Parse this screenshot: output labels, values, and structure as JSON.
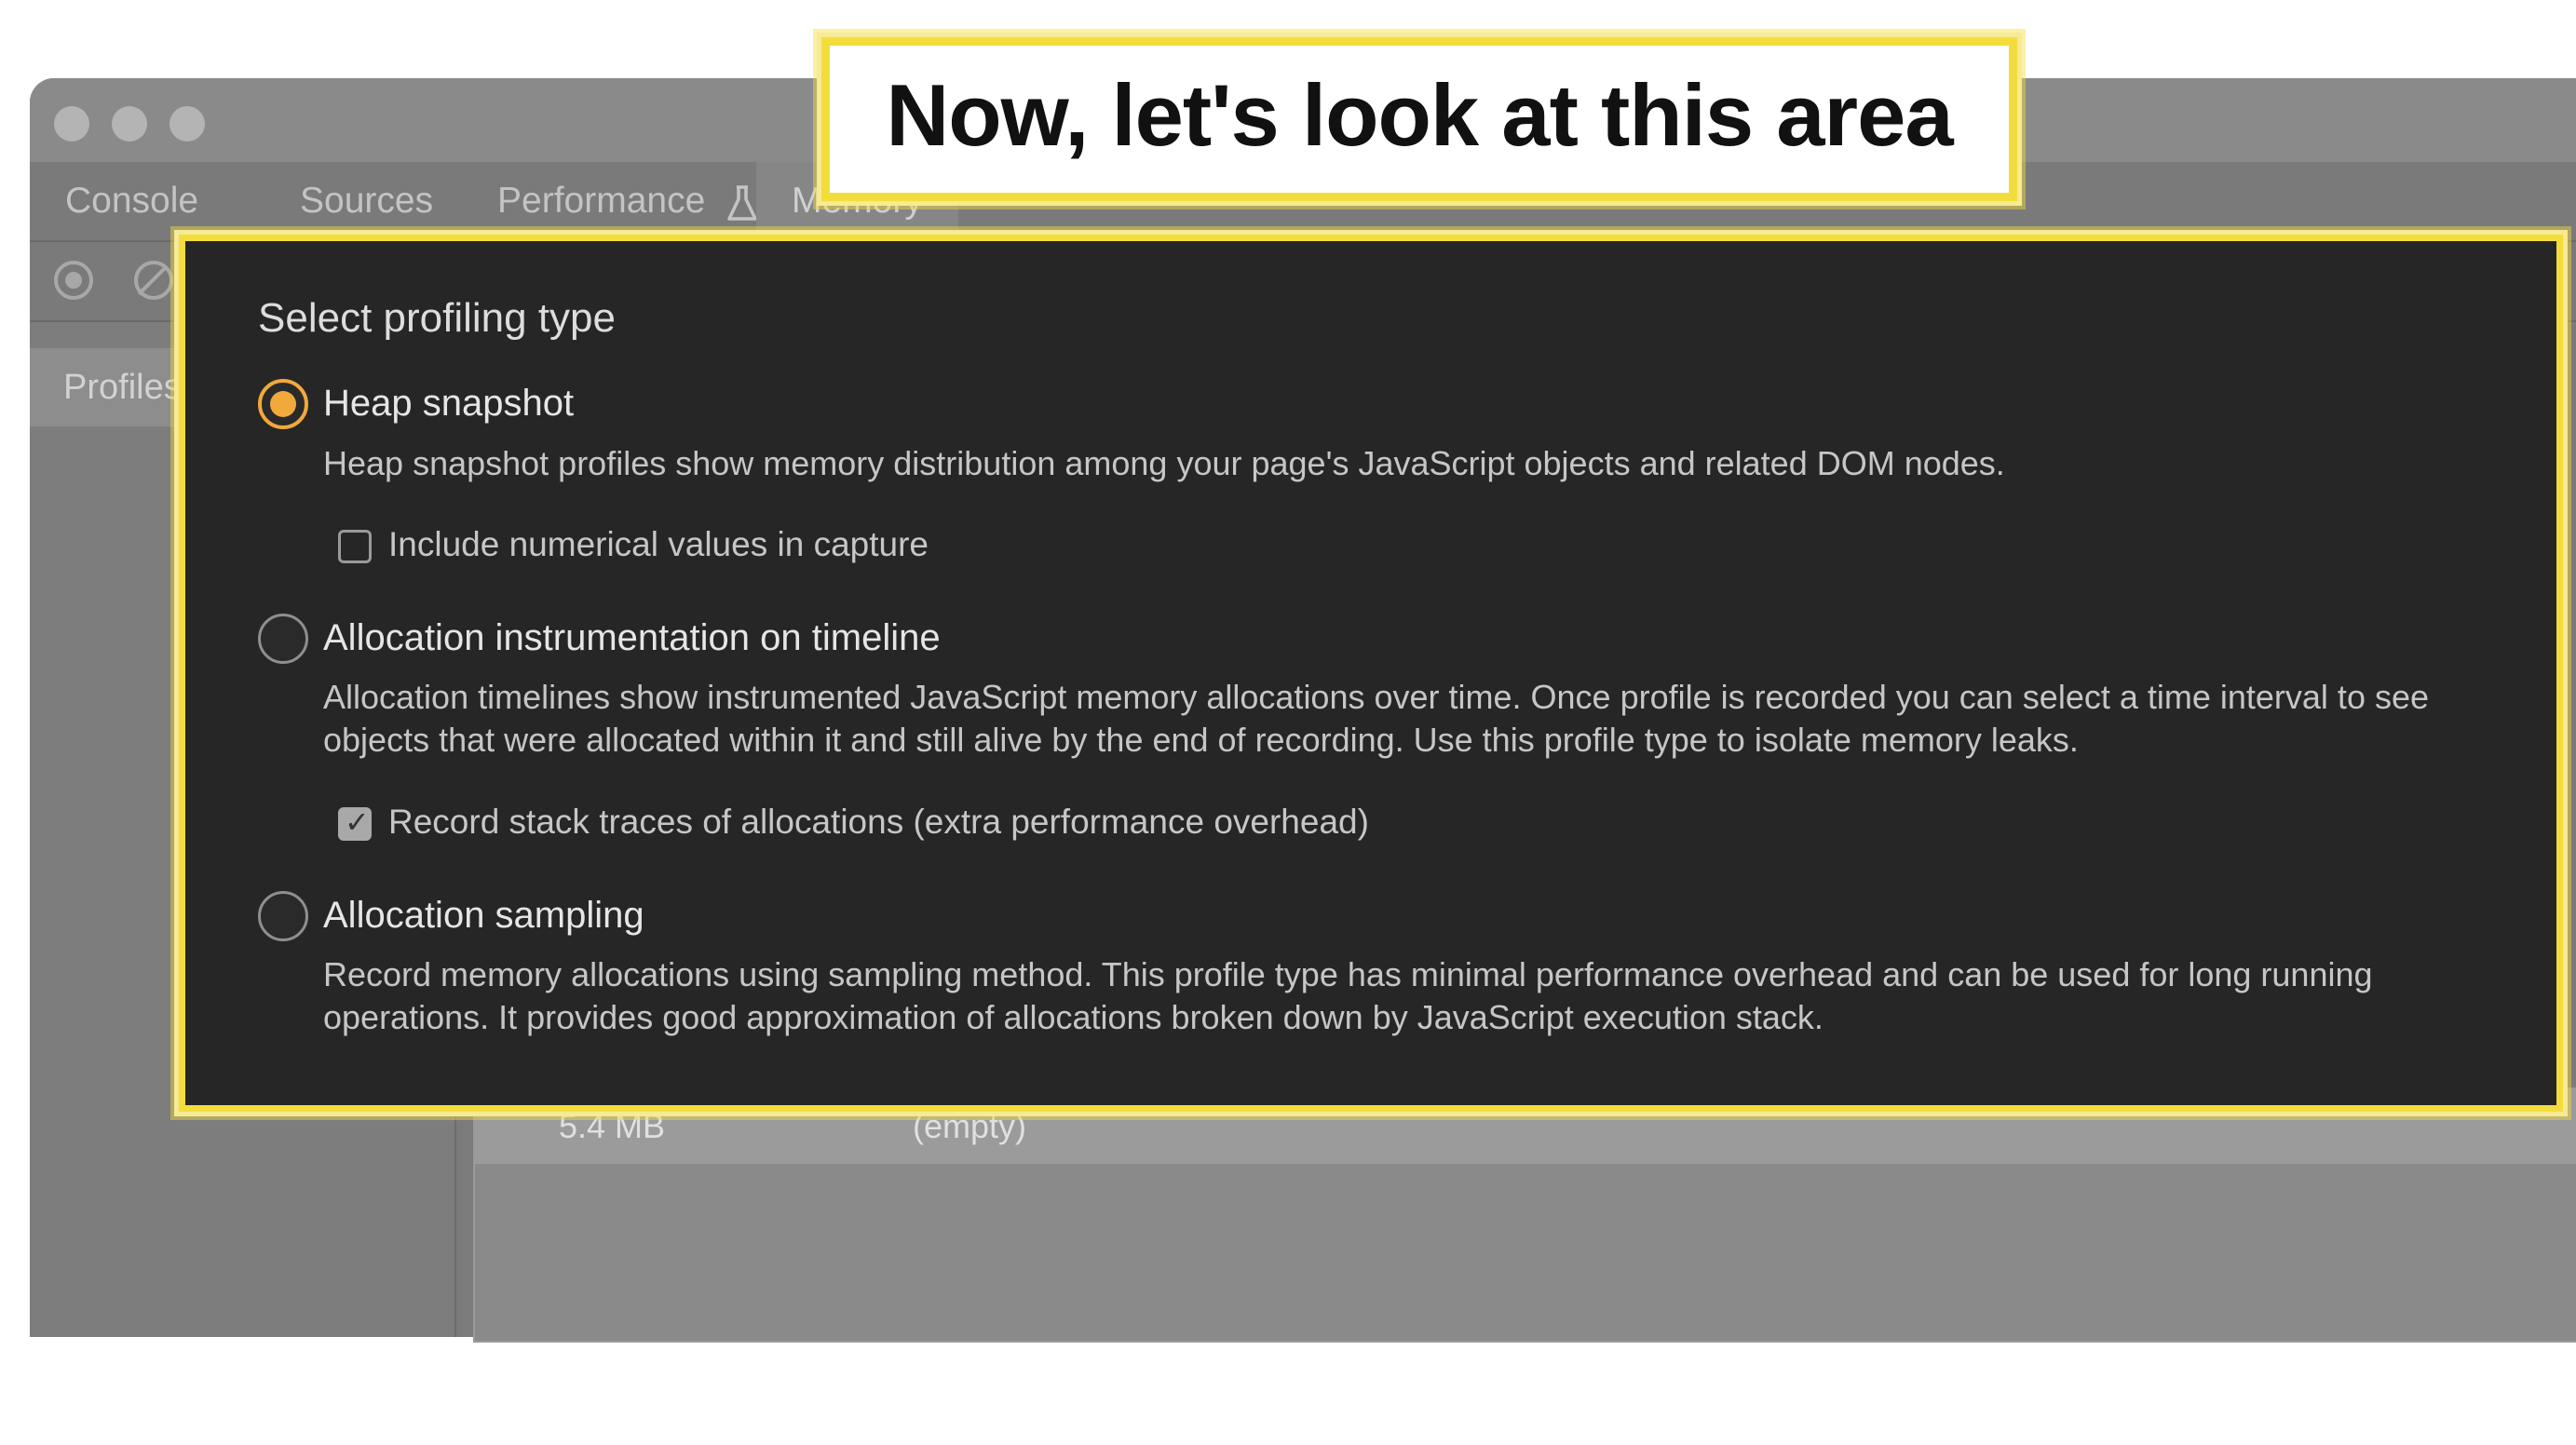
{
  "caption": {
    "text": "Now, let's look at this area"
  },
  "tabs": [
    {
      "label": "Console"
    },
    {
      "label": "Sources"
    },
    {
      "label": "Performance"
    },
    {
      "label": "Memory"
    }
  ],
  "sidebar": {
    "items": [
      {
        "label": "Profiles"
      }
    ]
  },
  "panel": {
    "title": "Select profiling type",
    "options": [
      {
        "label": "Heap snapshot",
        "selected": true,
        "description": "Heap snapshot profiles show memory distribution among your page's JavaScript objects and related DOM nodes.",
        "checkbox": {
          "label": "Include numerical values in capture",
          "checked": false
        }
      },
      {
        "label": "Allocation instrumentation on timeline",
        "selected": false,
        "description": "Allocation timelines show instrumented JavaScript memory allocations over time. Once profile is recorded you can select a time interval to see objects that were allocated within it and still alive by the end of recording. Use this profile type to isolate memory leaks.",
        "checkbox": {
          "label": "Record stack traces of allocations (extra performance overhead)",
          "checked": true
        }
      },
      {
        "label": "Allocation sampling",
        "selected": false,
        "description": "Record memory allocations using sampling method. This profile type has minimal performance overhead and can be used for long running operations. It provides good approximation of allocations broken down by JavaScript execution stack."
      }
    ]
  },
  "info_row": {
    "size": "5.4 MB",
    "status": "(empty)"
  },
  "colors": {
    "highlight": "#f3dd3c",
    "accent_radio": "#f2a93b",
    "panel_bg": "#262626"
  }
}
